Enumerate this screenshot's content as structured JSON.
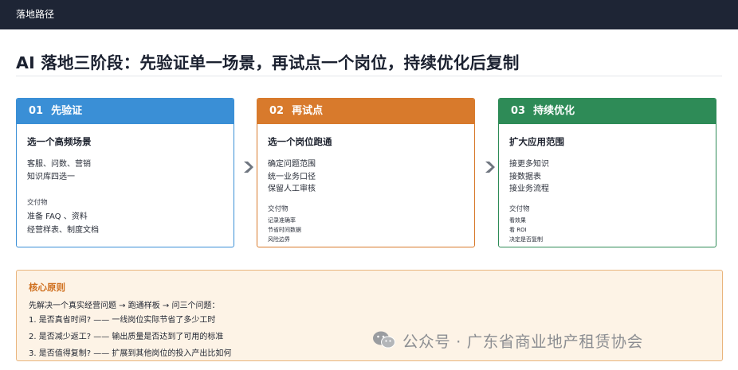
{
  "topbar": {
    "title": "落地路径"
  },
  "headline": "AI 落地三阶段：先验证单一场景，再试点一个岗位，持续优化后复制",
  "colors": {
    "blue": "#3a8fd6",
    "orange": "#d87a2c",
    "green": "#2e8b57"
  },
  "cards": [
    {
      "num": "01",
      "title": "先验证",
      "subtitle": "选一个高频场景",
      "lines": [
        "客服、问数、营销",
        "知识库四选一"
      ],
      "deliverable_label": "交付物",
      "deliverables": [
        "准备 FAQ 、资料",
        "经营样表、制度文档"
      ]
    },
    {
      "num": "02",
      "title": "再试点",
      "subtitle": "选一个岗位跑通",
      "lines": [
        "确定问题范围",
        "统一业务口径",
        "保留人工审核"
      ],
      "deliverable_label": "交付物",
      "deliverables": [
        "记录准确率",
        "节省时间数据",
        "风险边界"
      ]
    },
    {
      "num": "03",
      "title": "持续优化",
      "subtitle": "扩大应用范围",
      "lines": [
        "接更多知识",
        "接数据表",
        "接业务流程"
      ],
      "deliverable_label": "交付物",
      "deliverables": [
        "看效果",
        "看 ROI",
        "决定是否复制"
      ]
    }
  ],
  "principle": {
    "title": "核心原则",
    "intro": "先解决一个真实经营问题 → 跑通样板 → 问三个问题：",
    "questions": [
      {
        "q": "1.  是否真省时间?",
        "a": "—— 一线岗位实际节省了多少工时"
      },
      {
        "q": "2.  是否减少返工?",
        "a": "—— 输出质量是否达到了可用的标准"
      },
      {
        "q": "3.  是否值得复制?",
        "a": "—— 扩展到其他岗位的投入产出比如何"
      }
    ]
  },
  "watermark": {
    "text": "公众号 · 广东省商业地产租赁协会",
    "icon": "wechat-icon"
  }
}
